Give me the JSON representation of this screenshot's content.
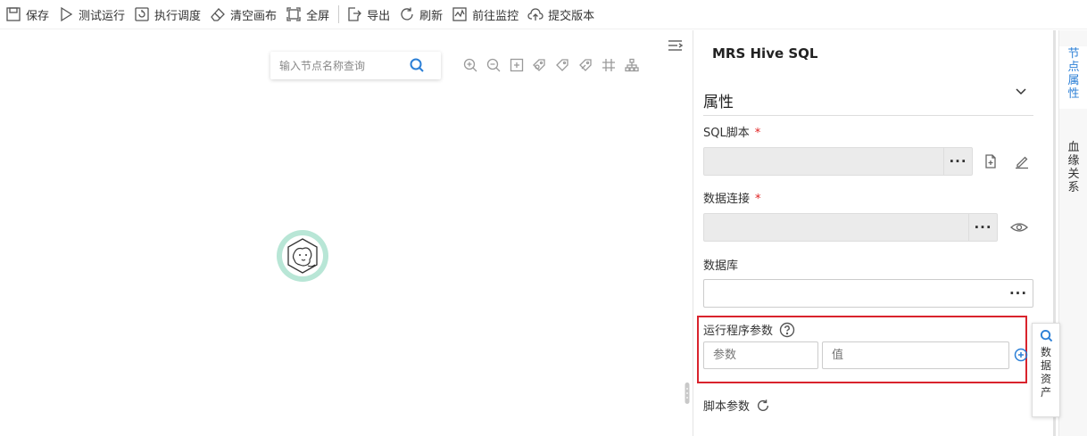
{
  "toolbar": {
    "save": "保存",
    "test_run": "测试运行",
    "schedule": "执行调度",
    "clear": "清空画布",
    "fullscreen": "全屏",
    "export": "导出",
    "refresh": "刷新",
    "monitor": "前往监控",
    "submit": "提交版本"
  },
  "canvas": {
    "search_placeholder": "输入节点名称查询",
    "tool_icons": [
      "zoom-in-icon",
      "zoom-out-icon",
      "fit-icon",
      "tag-settings-icon",
      "tag-icon",
      "tag-remove-icon",
      "grid-icon",
      "layout-icon"
    ]
  },
  "panel": {
    "title": "MRS Hive SQL",
    "section": "属性",
    "sql_script_label": "SQL脚本",
    "data_connection_label": "数据连接",
    "database_label": "数据库",
    "program_params_label": "运行程序参数",
    "param_placeholder": "参数",
    "value_placeholder": "值",
    "script_params_label": "脚本参数",
    "required_mark": "*",
    "more": "···"
  },
  "right_tabs": {
    "node_properties": [
      "节",
      "点",
      "属",
      "性"
    ],
    "lineage": [
      "血",
      "缘",
      "关",
      "系"
    ]
  },
  "data_assets": [
    "数",
    "据",
    "资",
    "产"
  ],
  "colors": {
    "accent": "#2b7fd6",
    "highlight_border": "#d9232d",
    "node_ring": "#b8e6d6",
    "required": "#e02020"
  }
}
